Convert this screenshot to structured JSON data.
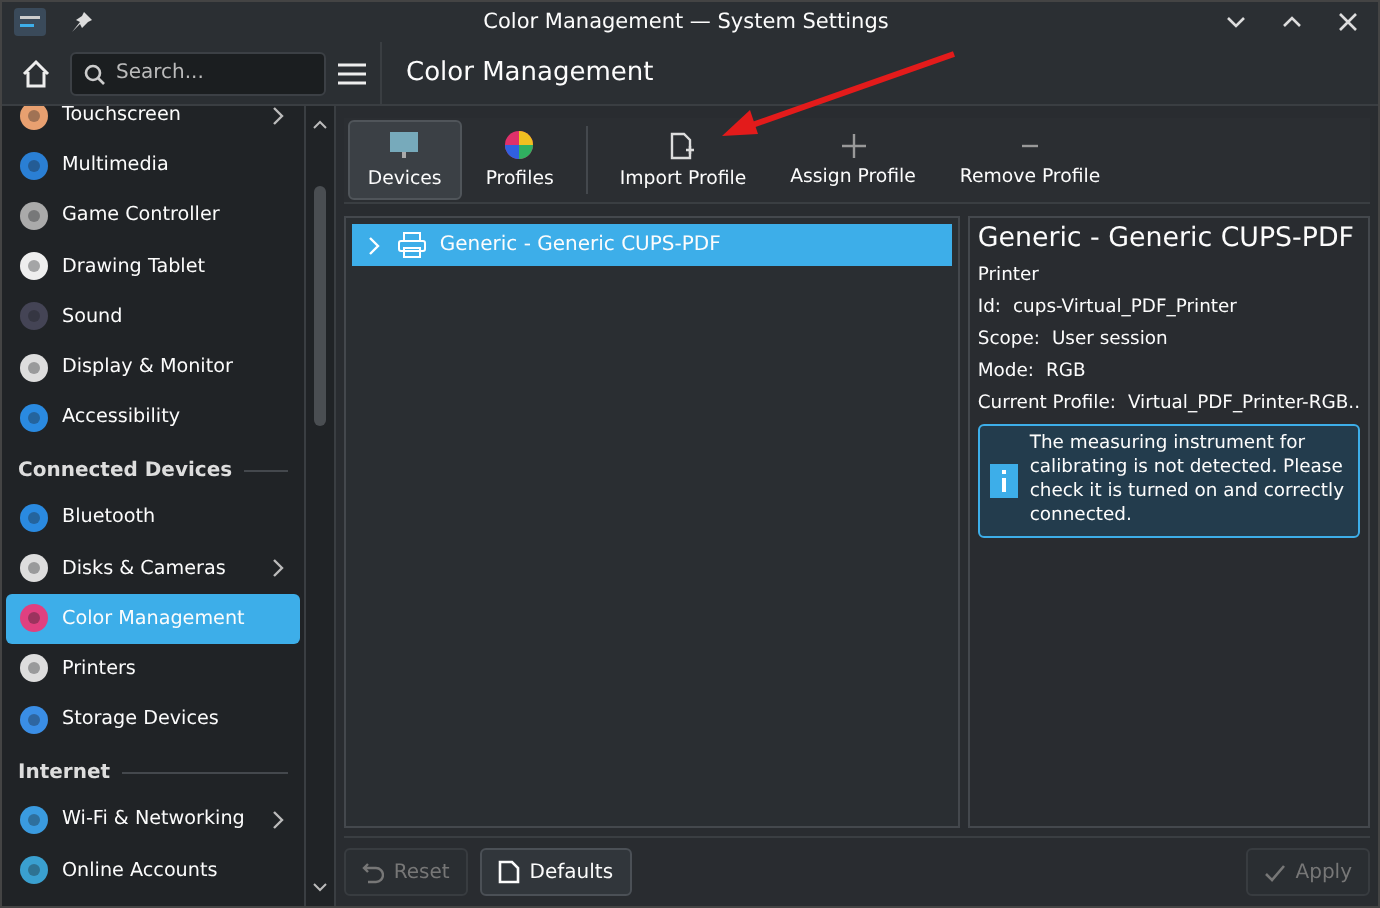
{
  "window": {
    "title": "Color Management — System Settings"
  },
  "search": {
    "placeholder": "Search..."
  },
  "page_title": "Color Management",
  "sidebar": {
    "sections": [
      {
        "items": [
          {
            "label": "Touchscreen",
            "selected": false,
            "submenu": true
          },
          {
            "label": "Multimedia",
            "selected": false,
            "submenu": false
          },
          {
            "label": "Game Controller",
            "selected": false,
            "submenu": false
          },
          {
            "label": "Drawing Tablet",
            "selected": false,
            "submenu": false
          },
          {
            "label": "Sound",
            "selected": false,
            "submenu": false
          },
          {
            "label": "Display & Monitor",
            "selected": false,
            "submenu": false
          },
          {
            "label": "Accessibility",
            "selected": false,
            "submenu": false
          }
        ]
      },
      {
        "title": "Connected Devices",
        "items": [
          {
            "label": "Bluetooth",
            "selected": false,
            "submenu": false
          },
          {
            "label": "Disks & Cameras",
            "selected": false,
            "submenu": true
          },
          {
            "label": "Color Management",
            "selected": true,
            "submenu": false
          },
          {
            "label": "Printers",
            "selected": false,
            "submenu": false
          },
          {
            "label": "Storage Devices",
            "selected": false,
            "submenu": false
          }
        ]
      },
      {
        "title": "Internet",
        "items": [
          {
            "label": "Wi-Fi & Networking",
            "selected": false,
            "submenu": true
          },
          {
            "label": "Online Accounts",
            "selected": false,
            "submenu": false
          }
        ]
      }
    ]
  },
  "toolbar": {
    "views": [
      {
        "label": "Devices",
        "selected": true
      },
      {
        "label": "Profiles",
        "selected": false
      }
    ],
    "actions": [
      {
        "label": "Import Profile"
      },
      {
        "label": "Assign Profile"
      },
      {
        "label": "Remove Profile"
      }
    ]
  },
  "devices": [
    {
      "label": "Generic - Generic CUPS-PDF",
      "selected": true,
      "expanded": false
    }
  ],
  "details": {
    "title": "Generic - Generic CUPS-PDF",
    "subtitle": "Printer",
    "fields": [
      {
        "label": "Id:",
        "value": "cups-Virtual_PDF_Printer"
      },
      {
        "label": "Scope:",
        "value": "User session"
      },
      {
        "label": "Mode:",
        "value": "RGB"
      },
      {
        "label": "Current Profile:",
        "value": "Virtual_PDF_Printer-RGB.."
      }
    ],
    "message": "The measuring instrument for calibrating is not detected. Please check it is turned on and correctly connected."
  },
  "footer": {
    "buttons": [
      {
        "label": "Reset",
        "disabled": true,
        "kind": "reset"
      },
      {
        "label": "Defaults",
        "disabled": false,
        "kind": "defaults"
      },
      {
        "label": "Apply",
        "disabled": true,
        "kind": "apply"
      }
    ]
  }
}
